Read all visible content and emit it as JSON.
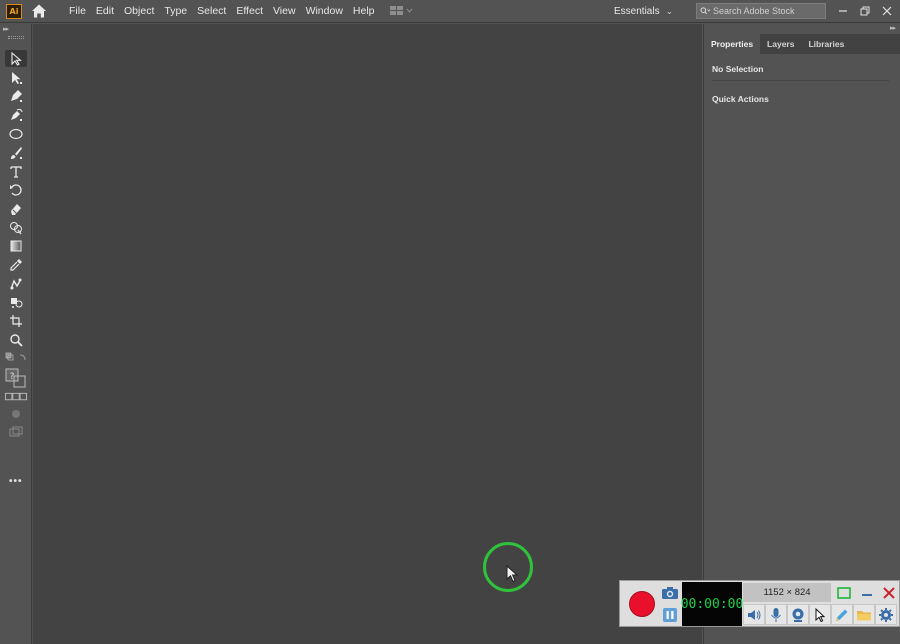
{
  "app": {
    "logo_text": "Ai",
    "menus": [
      "File",
      "Edit",
      "Object",
      "Type",
      "Select",
      "Effect",
      "View",
      "Window",
      "Help"
    ],
    "workspace_label": "Essentials",
    "search_placeholder": "Search Adobe Stock"
  },
  "toolbar": {
    "tools": [
      "selection-tool",
      "direct-selection-tool",
      "pen-tool",
      "curvature-tool",
      "ellipse-tool",
      "paintbrush-tool",
      "type-tool",
      "rotate-tool",
      "eraser-tool",
      "shape-builder-tool",
      "gradient-tool",
      "eyedropper-tool",
      "blend-tool",
      "symbol-sprayer-tool",
      "artboard-tool",
      "zoom-tool"
    ],
    "more_label": "•••"
  },
  "panel": {
    "tabs": [
      "Properties",
      "Layers",
      "Libraries"
    ],
    "active_tab": "Properties",
    "no_selection": "No Selection",
    "quick_actions": "Quick Actions"
  },
  "recorder": {
    "timer": "00:00:00",
    "resolution": "1152 × 824",
    "colors": {
      "record": "#e8102b",
      "timer_text": "#1bd14a",
      "highlight": "#2fc23a"
    }
  }
}
